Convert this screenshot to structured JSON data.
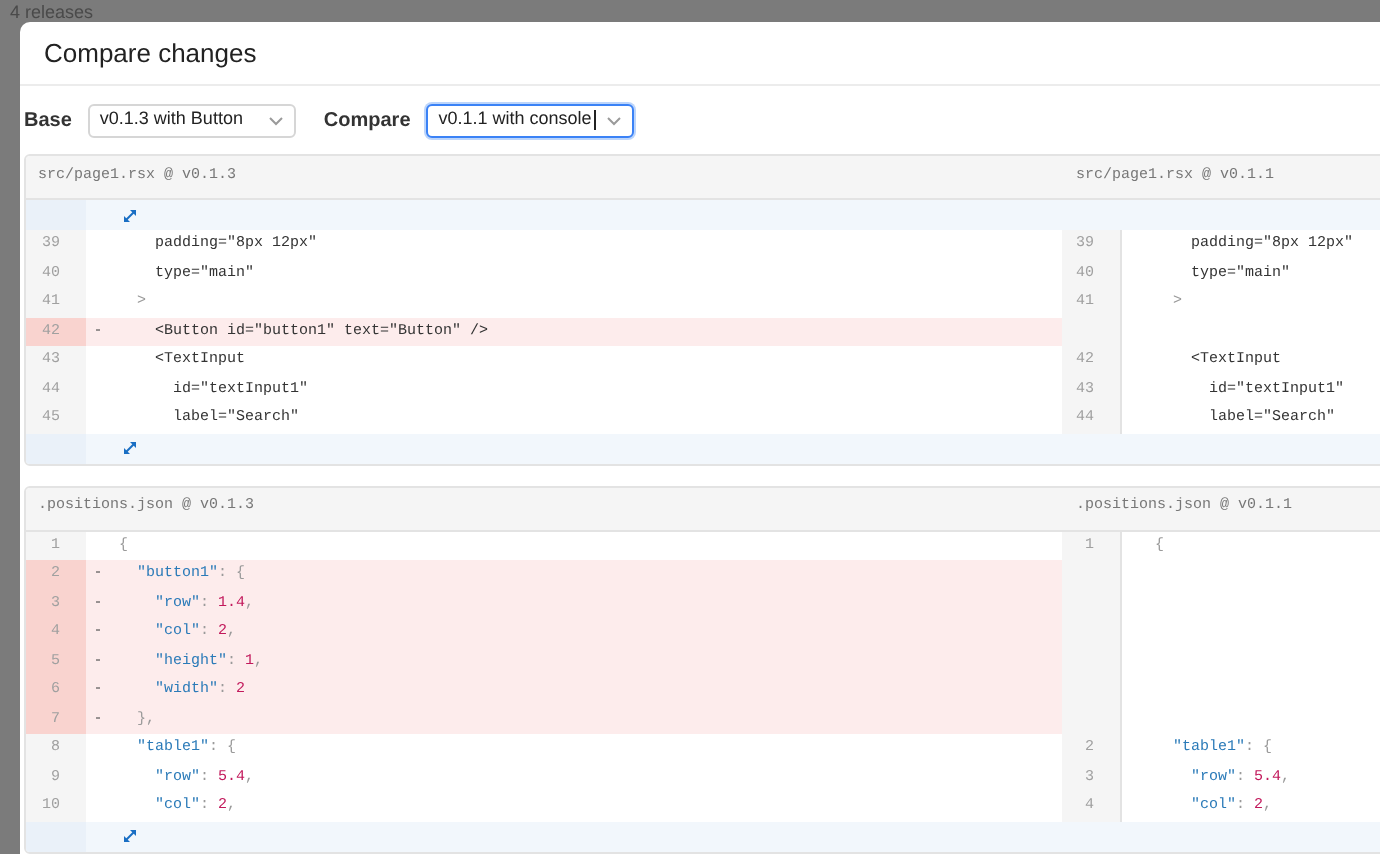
{
  "background": {
    "label": "4 releases"
  },
  "dialog": {
    "title": "Compare changes",
    "selects": [
      {
        "label": "Base",
        "value": "v0.1.3 with Button",
        "focused": false
      },
      {
        "label": "Compare",
        "value": "v0.1.1 with console",
        "focused": true
      }
    ],
    "diffs": [
      {
        "left_title": "src/page1.rsx @ v0.1.3",
        "right_title": "src/page1.rsx @ v0.1.1",
        "expand_top": true,
        "expand_bottom": true,
        "rows": [
          {
            "kind": "context",
            "left": {
              "number": "39",
              "tokens": [
                {
                  "text": "     padding=\"8px 12px\"",
                  "kind": "plain"
                }
              ]
            },
            "right": {
              "number": "39",
              "tokens": [
                {
                  "text": "     padding=\"8px 12px\"",
                  "kind": "plain"
                }
              ]
            }
          },
          {
            "kind": "context",
            "left": {
              "number": "40",
              "tokens": [
                {
                  "text": "     type=\"main\"",
                  "kind": "plain"
                }
              ]
            },
            "right": {
              "number": "40",
              "tokens": [
                {
                  "text": "     type=\"main\"",
                  "kind": "plain"
                }
              ]
            }
          },
          {
            "kind": "context",
            "left": {
              "number": "41",
              "tokens": [
                {
                  "text": "   >",
                  "kind": "punct"
                }
              ]
            },
            "right": {
              "number": "41",
              "tokens": [
                {
                  "text": "   >",
                  "kind": "punct"
                }
              ]
            }
          },
          {
            "kind": "removed",
            "marker": "-",
            "left": {
              "number": "42",
              "tokens": [
                {
                  "text": "     <Button id=\"button1\" text=\"Button\" />",
                  "kind": "plain"
                }
              ]
            }
          },
          {
            "kind": "context",
            "left": {
              "number": "43",
              "tokens": [
                {
                  "text": "     <TextInput",
                  "kind": "plain"
                }
              ]
            },
            "right": {
              "number": "42",
              "tokens": [
                {
                  "text": "     <TextInput",
                  "kind": "plain"
                }
              ]
            }
          },
          {
            "kind": "context",
            "left": {
              "number": "44",
              "tokens": [
                {
                  "text": "       id=\"textInput1\"",
                  "kind": "plain"
                }
              ]
            },
            "right": {
              "number": "43",
              "tokens": [
                {
                  "text": "       id=\"textInput1\"",
                  "kind": "plain"
                }
              ]
            }
          },
          {
            "kind": "context",
            "left": {
              "number": "45",
              "tokens": [
                {
                  "text": "       label=\"Search\"",
                  "kind": "plain"
                }
              ]
            },
            "right": {
              "number": "44",
              "tokens": [
                {
                  "text": "       label=\"Search\"",
                  "kind": "plain"
                }
              ]
            }
          }
        ]
      },
      {
        "left_title": ".positions.json @ v0.1.3",
        "right_title": ".positions.json @ v0.1.1",
        "expand_top": false,
        "expand_bottom": true,
        "rows": [
          {
            "kind": "context",
            "left": {
              "number": "1",
              "tokens": [
                {
                  "text": " {",
                  "kind": "punct"
                }
              ]
            },
            "right": {
              "number": "1",
              "tokens": [
                {
                  "text": " {",
                  "kind": "punct"
                }
              ]
            }
          },
          {
            "kind": "removed",
            "marker": "-",
            "left": {
              "number": "2",
              "tokens": [
                {
                  "text": "   \"button1\"",
                  "kind": "key"
                },
                {
                  "text": ": {",
                  "kind": "punct"
                }
              ]
            }
          },
          {
            "kind": "removed",
            "marker": "-",
            "left": {
              "number": "3",
              "tokens": [
                {
                  "text": "     \"row\"",
                  "kind": "key"
                },
                {
                  "text": ": ",
                  "kind": "punct"
                },
                {
                  "text": "1.4",
                  "kind": "number"
                },
                {
                  "text": ",",
                  "kind": "punct"
                }
              ]
            }
          },
          {
            "kind": "removed",
            "marker": "-",
            "left": {
              "number": "4",
              "tokens": [
                {
                  "text": "     \"col\"",
                  "kind": "key"
                },
                {
                  "text": ": ",
                  "kind": "punct"
                },
                {
                  "text": "2",
                  "kind": "number"
                },
                {
                  "text": ",",
                  "kind": "punct"
                }
              ]
            }
          },
          {
            "kind": "removed",
            "marker": "-",
            "left": {
              "number": "5",
              "tokens": [
                {
                  "text": "     \"height\"",
                  "kind": "key"
                },
                {
                  "text": ": ",
                  "kind": "punct"
                },
                {
                  "text": "1",
                  "kind": "number"
                },
                {
                  "text": ",",
                  "kind": "punct"
                }
              ]
            }
          },
          {
            "kind": "removed",
            "marker": "-",
            "left": {
              "number": "6",
              "tokens": [
                {
                  "text": "     \"width\"",
                  "kind": "key"
                },
                {
                  "text": ": ",
                  "kind": "punct"
                },
                {
                  "text": "2",
                  "kind": "number"
                }
              ]
            }
          },
          {
            "kind": "removed",
            "marker": "-",
            "left": {
              "number": "7",
              "tokens": [
                {
                  "text": "   },",
                  "kind": "punct"
                }
              ]
            }
          },
          {
            "kind": "context",
            "left": {
              "number": "8",
              "tokens": [
                {
                  "text": "   \"table1\"",
                  "kind": "key"
                },
                {
                  "text": ": {",
                  "kind": "punct"
                }
              ]
            },
            "right": {
              "number": "2",
              "tokens": [
                {
                  "text": "   \"table1\"",
                  "kind": "key"
                },
                {
                  "text": ": {",
                  "kind": "punct"
                }
              ]
            }
          },
          {
            "kind": "context",
            "left": {
              "number": "9",
              "tokens": [
                {
                  "text": "     \"row\"",
                  "kind": "key"
                },
                {
                  "text": ": ",
                  "kind": "punct"
                },
                {
                  "text": "5.4",
                  "kind": "number"
                },
                {
                  "text": ",",
                  "kind": "punct"
                }
              ]
            },
            "right": {
              "number": "3",
              "tokens": [
                {
                  "text": "     \"row\"",
                  "kind": "key"
                },
                {
                  "text": ": ",
                  "kind": "punct"
                },
                {
                  "text": "5.4",
                  "kind": "number"
                },
                {
                  "text": ",",
                  "kind": "punct"
                }
              ]
            }
          },
          {
            "kind": "context",
            "left": {
              "number": "10",
              "tokens": [
                {
                  "text": "     \"col\"",
                  "kind": "key"
                },
                {
                  "text": ": ",
                  "kind": "punct"
                },
                {
                  "text": "2",
                  "kind": "number"
                },
                {
                  "text": ",",
                  "kind": "punct"
                }
              ]
            },
            "right": {
              "number": "4",
              "tokens": [
                {
                  "text": "     \"col\"",
                  "kind": "key"
                },
                {
                  "text": ": ",
                  "kind": "punct"
                },
                {
                  "text": "2",
                  "kind": "number"
                },
                {
                  "text": ",",
                  "kind": "punct"
                }
              ]
            }
          }
        ]
      }
    ]
  }
}
